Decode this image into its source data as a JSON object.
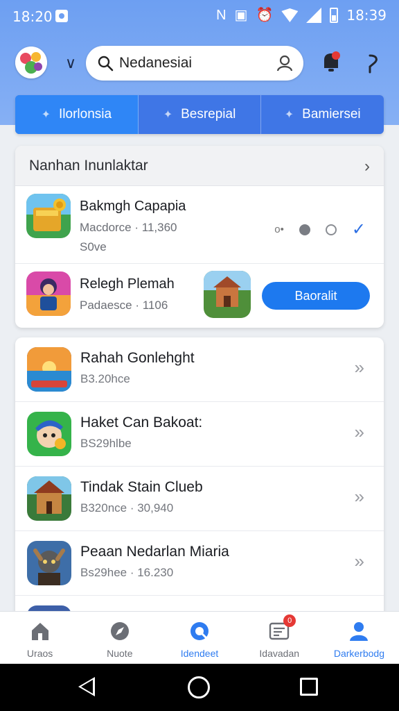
{
  "status_bar": {
    "time_left": "18:20",
    "time_right": "18:39",
    "nfc_label": "N"
  },
  "header": {
    "search_text": "Nedanesiai"
  },
  "tabs": [
    {
      "label": "Ilorlonsia",
      "active": true
    },
    {
      "label": "Besrepial",
      "active": false
    },
    {
      "label": "Bamiersei",
      "active": false
    }
  ],
  "featured": {
    "title": "Nanhan Inunlaktar",
    "item1": {
      "name": "Bakmgh Capapia",
      "meta": "Macdorce · 11,360",
      "sub": "S0ve",
      "dots_label": "o•"
    },
    "item2": {
      "name": "Relegh Plemah",
      "meta": "Padaesce · 1106",
      "button": "Baoralit"
    }
  },
  "list": [
    {
      "name": "Rahah Gonlehght",
      "meta": "B3.20hce"
    },
    {
      "name": "Haket Can Bakoat:",
      "meta": "BS29hlbe"
    },
    {
      "name": "Tindak Stain Clueb",
      "meta": "B320nce · 30,940"
    },
    {
      "name": "Peaan Nedarlan Miaria",
      "meta": "Bs29hee · 16.230"
    }
  ],
  "bottom_nav": [
    {
      "label": "Uraos",
      "icon": "home-icon",
      "active": false
    },
    {
      "label": "Nuote",
      "icon": "compass-icon",
      "active": false
    },
    {
      "label": "Idendeet",
      "icon": "discover-icon",
      "active": true
    },
    {
      "label": "Idavadan",
      "icon": "news-icon",
      "active": false,
      "badge": "0"
    },
    {
      "label": "Darkerbodg",
      "icon": "profile-icon",
      "active": true
    }
  ],
  "colors": {
    "accent": "#2f7cf0",
    "header_bg": "#6d9ff2",
    "tab_bg": "#3f76e6",
    "button": "#1d79ef"
  }
}
